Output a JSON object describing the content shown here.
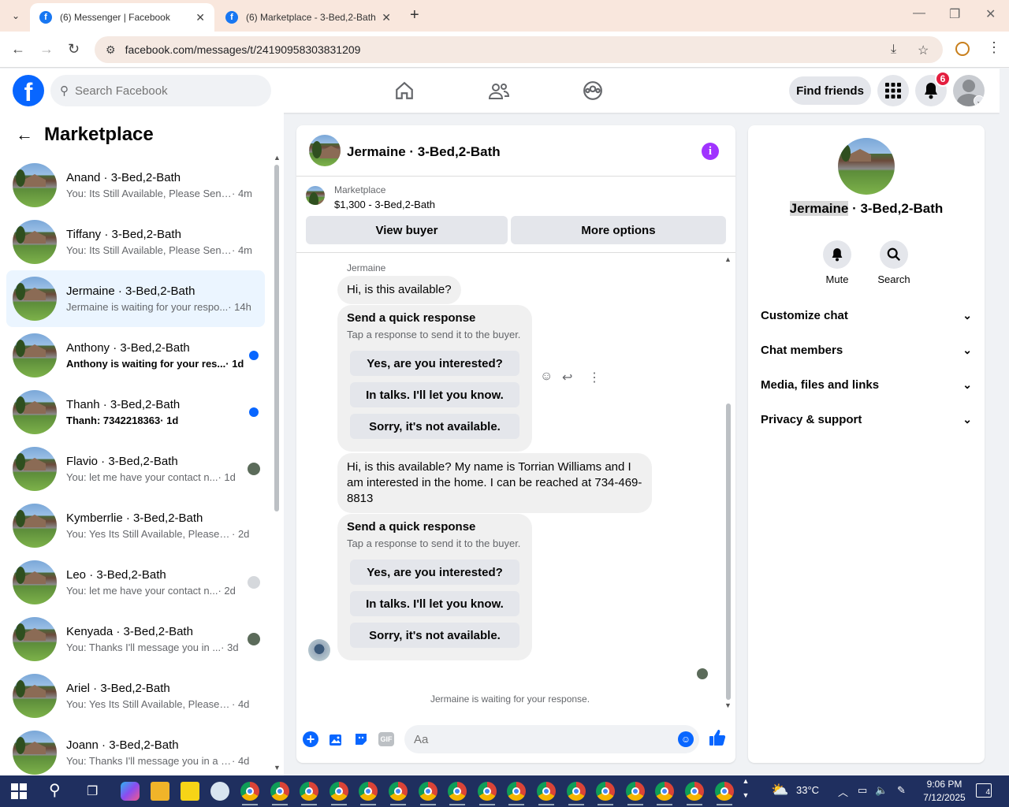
{
  "browser": {
    "tabs": [
      {
        "title": "(6) Messenger | Facebook",
        "active": true
      },
      {
        "title": "(6) Marketplace - 3-Bed,2-Bath",
        "active": false
      }
    ],
    "url": "facebook.com/messages/t/24190958303831209"
  },
  "header": {
    "search_placeholder": "Search Facebook",
    "find_friends": "Find friends",
    "notification_count": "6"
  },
  "sidebar": {
    "title": "Marketplace",
    "conversations": [
      {
        "name": "Anand · 3-Bed,2-Bath",
        "preview": "You: Its Still Available, Please Send ...",
        "time": "· 4m",
        "unread": false,
        "selected": false
      },
      {
        "name": "Tiffany · 3-Bed,2-Bath",
        "preview": "You: Its Still Available, Please Send ...",
        "time": "· 4m",
        "unread": false,
        "selected": false
      },
      {
        "name": "Jermaine · 3-Bed,2-Bath",
        "preview": "Jermaine is waiting for your respo...",
        "time": "· 14h",
        "unread": false,
        "selected": true
      },
      {
        "name": "Anthony · 3-Bed,2-Bath",
        "preview": "Anthony is waiting for your res...",
        "time": "· 1d",
        "unread": true,
        "selected": false
      },
      {
        "name": "Thanh · 3-Bed,2-Bath",
        "preview": "Thanh: 7342218363",
        "time": "· 1d",
        "unread": true,
        "selected": false
      },
      {
        "name": "Flavio · 3-Bed,2-Bath",
        "preview": "You: let me have your contact n...",
        "time": "· 1d",
        "unread": false,
        "selected": false
      },
      {
        "name": "Kymberrlie · 3-Bed,2-Bath",
        "preview": "You: Yes Its Still Available, Please Se...",
        "time": "· 2d",
        "unread": false,
        "selected": false
      },
      {
        "name": "Leo · 3-Bed,2-Bath",
        "preview": "You: let me have your contact n...",
        "time": "· 2d",
        "unread": false,
        "selected": false
      },
      {
        "name": "Kenyada · 3-Bed,2-Bath",
        "preview": "You: Thanks I'll message you in ...",
        "time": "· 3d",
        "unread": false,
        "selected": false
      },
      {
        "name": "Ariel · 3-Bed,2-Bath",
        "preview": "You: Yes Its Still Available, Please Se...",
        "time": "· 4d",
        "unread": false,
        "selected": false
      },
      {
        "name": "Joann · 3-Bed,2-Bath",
        "preview": "You: Thanks I'll message you in a m...",
        "time": "· 4d",
        "unread": false,
        "selected": false
      }
    ]
  },
  "chat": {
    "title": "Jermaine · 3-Bed,2-Bath",
    "listing_label": "Marketplace",
    "listing_price": "$1,300 - 3-Bed,2-Bath",
    "view_buyer": "View buyer",
    "more_options": "More options",
    "sender": "Jermaine",
    "msg1": "Hi, is this available?",
    "quick_title": "Send a quick response",
    "quick_sub": "Tap a response to send it to the buyer.",
    "quick_options": [
      "Yes, are you interested?",
      "In talks. I'll let you know.",
      "Sorry, it's not available."
    ],
    "msg2": "Hi, is this available? My name is Torrian Williams and I am interested in the home. I can be reached at 734-469-8813",
    "waiting": "Jermaine is waiting for your response.",
    "input_placeholder": "Aa"
  },
  "details": {
    "name_first": "Jermaine",
    "name_rest": " · 3-Bed,2-Bath",
    "mute": "Mute",
    "search": "Search",
    "sections": [
      "Customize chat",
      "Chat members",
      "Media, files and links",
      "Privacy & support"
    ]
  },
  "taskbar": {
    "temperature": "33°C",
    "time": "9:06 PM",
    "date": "7/12/2025",
    "notifications": "4"
  },
  "colors": {
    "brand": "#0866ff",
    "info": "#a033ff",
    "badge": "#e41e3f"
  }
}
